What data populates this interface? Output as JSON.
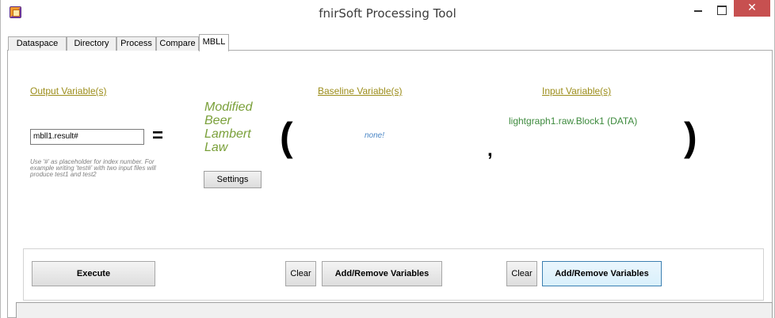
{
  "window": {
    "title": "fnirSoft Processing Tool",
    "close_glyph": "✕"
  },
  "tabs": [
    {
      "label": "Dataspace",
      "active": false
    },
    {
      "label": "Directory",
      "active": false
    },
    {
      "label": "Process",
      "active": false
    },
    {
      "label": "Compare",
      "active": false
    },
    {
      "label": "MBLL",
      "active": true
    }
  ],
  "mbll": {
    "output_header": "Output Variable(s)",
    "baseline_header": "Baseline Variable(s)",
    "input_header": "Input Variable(s)",
    "output_value": "mbll1.result#",
    "equals": "=",
    "hint": "Use '#' as placeholder for index number. For example writing 'test#' with two input files will produce test1 and test2",
    "method_label": "Modified Beer Lambert Law",
    "settings_label": "Settings",
    "paren_open": "(",
    "paren_close": ")",
    "comma": ",",
    "baseline_value": "none!",
    "input_value": "lightgraph1.raw.Block1 (DATA)"
  },
  "actions": {
    "execute_label": "Execute",
    "baseline_clear_label": "Clear",
    "baseline_addremove_label": "Add/Remove Variables",
    "input_clear_label": "Clear",
    "input_addremove_label": "Add/Remove Variables"
  },
  "colors": {
    "header_text": "#9c8d1a",
    "method_text": "#7aa03a",
    "baseline_text": "#4a86c5",
    "input_text": "#3d8a3d",
    "close_button": "#c75050"
  }
}
